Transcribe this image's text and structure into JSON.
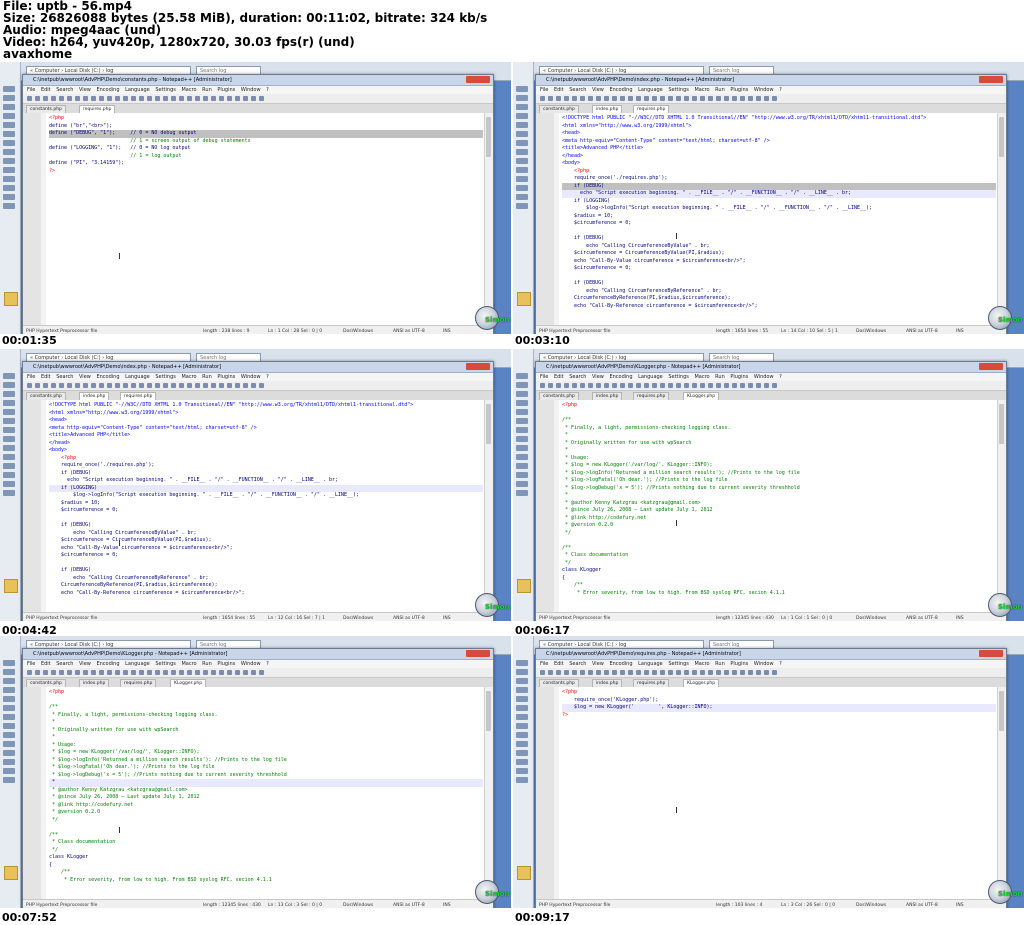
{
  "info": {
    "file": "File: uptb - 56.mp4",
    "size": "Size: 26826088 bytes (25.58 MiB), duration: 00:11:02, bitrate: 324 kb/s",
    "audio": "Audio: mpeg4aac (und)",
    "video": "Video: h264, yuv420p, 1280x720, 30.03 fps(r) (und)",
    "source": "avaxhome"
  },
  "watermark": "Simon",
  "colors": {
    "desktop": "#5a83c4",
    "comment": "#008000",
    "php_tag": "#ff0000",
    "keyword": "#0000ff",
    "highlight": "#e8e8ff",
    "selection": "#c0c0c0",
    "watermark_text": "#1bd43a"
  },
  "thumbnails": [
    {
      "timestamp": "00:01:35",
      "title": "C:\\inetpub\\wwwroot\\AdvPHP\\Demo\\constants.php - Notepad++ [Administrator]",
      "tabs": [
        "constants.php",
        "requires.php"
      ],
      "lines": [
        {
          "t": "<?php",
          "k": "ph"
        },
        {
          "t": "define (\"br\",\"<br>\");",
          "k": ""
        },
        {
          "t": "define (\"DEBUG\", \"1\");     // 0 = NO debug output",
          "k": "sel"
        },
        {
          "t": "                           // 1 = screen output of debug statements",
          "k": "cm"
        },
        {
          "t": "define (\"LOGGING\", \"1\");   // 0 = NO log output",
          "k": ""
        },
        {
          "t": "                           // 1 = log output",
          "k": "cm"
        },
        {
          "t": "define (\"PI\", \"3.14159\");",
          "k": ""
        },
        {
          "t": "?>",
          "k": "ph"
        }
      ],
      "status": [
        "PHP Hypertext Preprocessor file",
        "length : 238    lines : 9",
        "Ln : 1    Col : 28    Sel : 0 | 0",
        "Dos\\Windows",
        "ANSI as UTF-8",
        "INS"
      ]
    },
    {
      "timestamp": "00:03:10",
      "title": "C:\\inetpub\\wwwroot\\AdvPHP\\Demo\\index.php - Notepad++ [Administrator]",
      "tabs": [
        "constants.php",
        "index.php",
        "requires.php"
      ],
      "lines": [
        {
          "t": "<!DOCTYPE html PUBLIC \"-//W3C//DTD XHTML 1.0 Transitional//EN\" \"http://www.w3.org/TR/xhtml1/DTD/xhtml1-transitional.dtd\">",
          "k": "tag"
        },
        {
          "t": "<html xmlns=\"http://www.w3.org/1999/xhtml\">",
          "k": "tag"
        },
        {
          "t": "<head>",
          "k": "tag"
        },
        {
          "t": "<meta http-equiv=\"Content-Type\" content=\"text/html; charset=utf-8\" />",
          "k": "tag"
        },
        {
          "t": "<title>Advanced PHP</title>",
          "k": "tag"
        },
        {
          "t": "</head>",
          "k": "tag"
        },
        {
          "t": "<body>",
          "k": "tag"
        },
        {
          "t": "    <?php",
          "k": "ph"
        },
        {
          "t": "    require_once('./requires.php');",
          "k": ""
        },
        {
          "t": "    if (DEBUG)",
          "k": "sel"
        },
        {
          "t": "      echo \"Script execution beginning. \" . __FILE__ . \"/\" . __FUNCTION__ . \"/\" . __LINE__ . br;",
          "k": "hl"
        },
        {
          "t": "    if (LOGGING)",
          "k": ""
        },
        {
          "t": "        $log->logInfo(\"Script execution beginning. \" . __FILE__ . \"/\" . __FUNCTION__ . \"/\" . __LINE__);",
          "k": ""
        },
        {
          "t": "    $radius = 10;",
          "k": ""
        },
        {
          "t": "    $circumference = 0;",
          "k": ""
        },
        {
          "t": "",
          "k": ""
        },
        {
          "t": "    if (DEBUG)",
          "k": ""
        },
        {
          "t": "        echo \"Calling CircumferenceByValue\" . br;",
          "k": ""
        },
        {
          "t": "    $circumference = CircumferenceByValue(PI,$radius);",
          "k": ""
        },
        {
          "t": "    echo \"Call-By-Value circumference = $circumference<br/>\";",
          "k": ""
        },
        {
          "t": "    $circumference = 0;",
          "k": ""
        },
        {
          "t": "",
          "k": ""
        },
        {
          "t": "    if (DEBUG)",
          "k": ""
        },
        {
          "t": "        echo \"Calling CircumferenceByReference\" . br;",
          "k": ""
        },
        {
          "t": "    CircumferenceByReference(PI,$radius,$circumference);",
          "k": ""
        },
        {
          "t": "    echo \"Call-By-Reference circumference = $circumference<br/>\";",
          "k": ""
        }
      ],
      "status": [
        "PHP Hypertext Preprocessor file",
        "length : 1654    lines : 55",
        "Ln : 14    Col : 10    Sel : 5 | 1",
        "Dos\\Windows",
        "ANSI as UTF-8",
        "INS"
      ]
    },
    {
      "timestamp": "00:04:42",
      "title": "C:\\inetpub\\wwwroot\\AdvPHP\\Demo\\index.php - Notepad++ [Administrator]",
      "tabs": [
        "constants.php",
        "index.php",
        "requires.php"
      ],
      "lines": [
        {
          "t": "<!DOCTYPE html PUBLIC \"-//W3C//DTD XHTML 1.0 Transitional//EN\" \"http://www.w3.org/TR/xhtml1/DTD/xhtml1-transitional.dtd\">",
          "k": "tag"
        },
        {
          "t": "<html xmlns=\"http://www.w3.org/1999/xhtml\">",
          "k": "tag"
        },
        {
          "t": "<head>",
          "k": "tag"
        },
        {
          "t": "<meta http-equiv=\"Content-Type\" content=\"text/html; charset=utf-8\" />",
          "k": "tag"
        },
        {
          "t": "<title>Advanced PHP</title>",
          "k": "tag"
        },
        {
          "t": "</head>",
          "k": "tag"
        },
        {
          "t": "<body>",
          "k": "tag"
        },
        {
          "t": "    <?php",
          "k": "ph"
        },
        {
          "t": "    require_once('./requires.php');",
          "k": ""
        },
        {
          "t": "    if (DEBUG)",
          "k": ""
        },
        {
          "t": "      echo \"Script execution beginning. \" . __FILE__ . \"/\" . __FUNCTION__ . \"/\" . __LINE__ . br;",
          "k": ""
        },
        {
          "t": "    if (LOGGING)",
          "k": "hl"
        },
        {
          "t": "        $log->logInfo(\"Script execution beginning. \" . __FILE__ . \"/\" . __FUNCTION__ . \"/\" . __LINE__);",
          "k": ""
        },
        {
          "t": "    $radius = 10;",
          "k": ""
        },
        {
          "t": "    $circumference = 0;",
          "k": ""
        },
        {
          "t": "",
          "k": ""
        },
        {
          "t": "    if (DEBUG)",
          "k": ""
        },
        {
          "t": "        echo \"Calling CircumferenceByValue\" . br;",
          "k": ""
        },
        {
          "t": "    $circumference = CircumferenceByValue(PI,$radius);",
          "k": ""
        },
        {
          "t": "    echo \"Call-By-Value circumference = $circumference<br/>\";",
          "k": ""
        },
        {
          "t": "    $circumference = 0;",
          "k": ""
        },
        {
          "t": "",
          "k": ""
        },
        {
          "t": "    if (DEBUG)",
          "k": ""
        },
        {
          "t": "        echo \"Calling CircumferenceByReference\" . br;",
          "k": ""
        },
        {
          "t": "    CircumferenceByReference(PI,$radius,$circumference);",
          "k": ""
        },
        {
          "t": "    echo \"Call-By-Reference circumference = $circumference<br/>\";",
          "k": ""
        }
      ],
      "status": [
        "PHP Hypertext Preprocessor file",
        "length : 1654    lines : 55",
        "Ln : 12    Col : 16    Sel : 7 | 1",
        "Dos\\Windows",
        "ANSI as UTF-8",
        "INS"
      ]
    },
    {
      "timestamp": "00:06:17",
      "title": "C:\\inetpub\\wwwroot\\AdvPHP\\Demo\\KLogger.php - Notepad++ [Administrator]",
      "tabs": [
        "constants.php",
        "index.php",
        "requires.php",
        "KLogger.php"
      ],
      "lines": [
        {
          "t": "<?php",
          "k": "ph"
        },
        {
          "t": "",
          "k": ""
        },
        {
          "t": "/**",
          "k": "cm"
        },
        {
          "t": " * Finally, a light, permissions-checking logging class.",
          "k": "cm"
        },
        {
          "t": " *",
          "k": "cm"
        },
        {
          "t": " * Originally written for use with wpSearch",
          "k": "cm"
        },
        {
          "t": " *",
          "k": "cm"
        },
        {
          "t": " * Usage:",
          "k": "cm"
        },
        {
          "t": " * $log = new KLogger('/var/log/', KLogger::INFO);",
          "k": "cm"
        },
        {
          "t": " * $log->logInfo('Returned a million search results'); //Prints to the log file",
          "k": "cm"
        },
        {
          "t": " * $log->logFatal('Oh dear.'); //Prints to the log file",
          "k": "cm"
        },
        {
          "t": " * $log->logDebug('x = 5'); //Prints nothing due to current severity threshhold",
          "k": "cm"
        },
        {
          "t": " *",
          "k": "cm"
        },
        {
          "t": " * @author Kenny Katzgrau <katzgrau@gmail.com>",
          "k": "cm"
        },
        {
          "t": " * @since July 26, 2008 — Last update July 1, 2012",
          "k": "cm"
        },
        {
          "t": " * @link http://codefury.net",
          "k": "cm"
        },
        {
          "t": " * @version 0.2.0",
          "k": "cm"
        },
        {
          "t": " */",
          "k": "cm"
        },
        {
          "t": "",
          "k": ""
        },
        {
          "t": "/**",
          "k": "cm"
        },
        {
          "t": " * Class documentation",
          "k": "cm"
        },
        {
          "t": " */",
          "k": "cm"
        },
        {
          "t": "class KLogger",
          "k": ""
        },
        {
          "t": "{",
          "k": ""
        },
        {
          "t": "    /**",
          "k": "cm"
        },
        {
          "t": "     * Error severity, from low to high. From BSD syslog RFC, secion 4.1.1",
          "k": "cm"
        }
      ],
      "status": [
        "PHP Hypertext Preprocessor file",
        "length : 12345    lines : 430",
        "Ln : 1    Col : 1    Sel : 0 | 0",
        "Dos\\Windows",
        "ANSI as UTF-8",
        "INS"
      ]
    },
    {
      "timestamp": "00:07:52",
      "title": "C:\\inetpub\\wwwroot\\AdvPHP\\Demo\\KLogger.php - Notepad++ [Administrator]",
      "tabs": [
        "constants.php",
        "index.php",
        "requires.php",
        "KLogger.php"
      ],
      "lines": [
        {
          "t": "<?php",
          "k": "ph"
        },
        {
          "t": "",
          "k": ""
        },
        {
          "t": "/**",
          "k": "cm"
        },
        {
          "t": " * Finally, a light, permissions-checking logging class.",
          "k": "cm"
        },
        {
          "t": " *",
          "k": "cm"
        },
        {
          "t": " * Originally written for use with wpSearch",
          "k": "cm"
        },
        {
          "t": " *",
          "k": "cm"
        },
        {
          "t": " * Usage:",
          "k": "cm"
        },
        {
          "t": " * $log = new KLogger('/var/log/', KLogger::INFO);",
          "k": "cm"
        },
        {
          "t": " * $log->logInfo('Returned a million search results'); //Prints to the log file",
          "k": "cm"
        },
        {
          "t": " * $log->logFatal('Oh dear.'); //Prints to the log file",
          "k": "cm"
        },
        {
          "t": " * $log->logDebug('x = 5'); //Prints nothing due to current severity threshhold",
          "k": "cm"
        },
        {
          "t": " *",
          "k": "hl"
        },
        {
          "t": " * @author Kenny Katzgrau <katzgrau@gmail.com>",
          "k": "cm"
        },
        {
          "t": " * @since July 26, 2008 — Last update July 1, 2012",
          "k": "cm"
        },
        {
          "t": " * @link http://codefury.net",
          "k": "cm"
        },
        {
          "t": " * @version 0.2.0",
          "k": "cm"
        },
        {
          "t": " */",
          "k": "cm"
        },
        {
          "t": "",
          "k": ""
        },
        {
          "t": "/**",
          "k": "cm"
        },
        {
          "t": " * Class documentation",
          "k": "cm"
        },
        {
          "t": " */",
          "k": "cm"
        },
        {
          "t": "class KLogger",
          "k": ""
        },
        {
          "t": "{",
          "k": ""
        },
        {
          "t": "    /**",
          "k": "cm"
        },
        {
          "t": "     * Error severity, from low to high. From BSD syslog RFC, secion 4.1.1",
          "k": "cm"
        }
      ],
      "status": [
        "PHP Hypertext Preprocessor file",
        "length : 12345    lines : 430",
        "Ln : 13    Col : 3    Sel : 0 | 0",
        "Dos\\Windows",
        "ANSI as UTF-8",
        "INS"
      ]
    },
    {
      "timestamp": "00:09:17",
      "title": "C:\\inetpub\\wwwroot\\AdvPHP\\Demo\\requires.php - Notepad++ [Administrator]",
      "tabs": [
        "constants.php",
        "index.php",
        "requires.php",
        "KLogger.php"
      ],
      "lines": [
        {
          "t": "<?php",
          "k": "ph"
        },
        {
          "t": "    require_once('KLogger.php');",
          "k": ""
        },
        {
          "t": "    $log = new KLogger('        ', KLogger::INFO);",
          "k": "hl"
        },
        {
          "t": "?>",
          "k": "ph"
        }
      ],
      "status": [
        "PHP Hypertext Preprocessor file",
        "length : 103    lines : 4",
        "Ln : 3    Col : 26    Sel : 0 | 0",
        "Dos\\Windows",
        "ANSI as UTF-8",
        "INS"
      ]
    }
  ],
  "window": {
    "menu": "File Edit Search View Encoding Language Settings Macro Run Plugins Window ?",
    "address": "« Computer › Local Disk (C:) › log",
    "search": "Search log"
  }
}
